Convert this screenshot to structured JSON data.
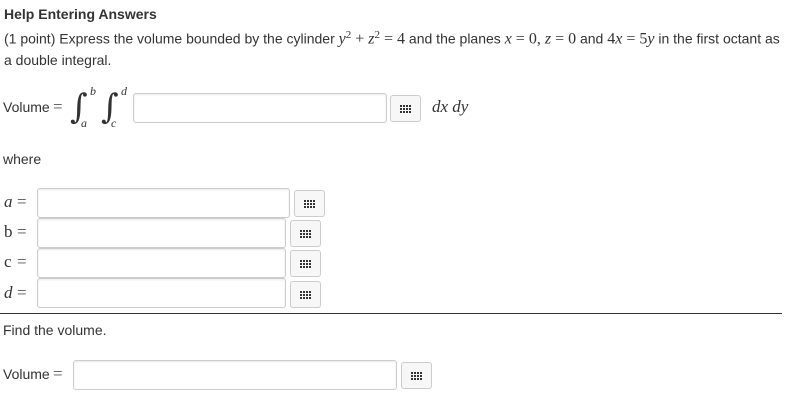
{
  "help_link": "Help Entering Answers",
  "problem": {
    "t1": "(1 point) Express the volume bounded by the cylinder ",
    "y": "y",
    "sup2a": "2",
    "plus": " + ",
    "z": "z",
    "sup2b": "2",
    "eq4": " = 4",
    "t2": " and the planes ",
    "x": "x",
    "eq0a": " = 0, ",
    "z2": "z",
    "eq0b": " = 0",
    "t3": " and ",
    "four": "4",
    "x2": "x",
    "eq": " = ",
    "five": "5",
    "y2": "y",
    "t4": " in the first octant as a double integral."
  },
  "volume_integral": {
    "label": "Volume",
    "equals": "=",
    "outer_upper": "b",
    "outer_lower": "a",
    "inner_upper": "d",
    "inner_lower": "c",
    "integral_symbol": "∫",
    "differentials": "dx dy",
    "input_value": ""
  },
  "where_label": "where",
  "limits": [
    {
      "var": "a",
      "equals": "=",
      "value": ""
    },
    {
      "var": "b",
      "equals": "=",
      "value": ""
    },
    {
      "var": "c",
      "equals": "=",
      "value": ""
    },
    {
      "var": "d",
      "equals": "=",
      "value": ""
    }
  ],
  "find_volume": {
    "prompt": "Find the volume.",
    "label": "Volume",
    "equals": "=",
    "input_value": ""
  },
  "icons": {
    "equation_editor": "grid-keypad-icon"
  },
  "colors": {
    "text": "#333333",
    "border": "#cccccc",
    "button_bg": "#f7f7f7"
  }
}
